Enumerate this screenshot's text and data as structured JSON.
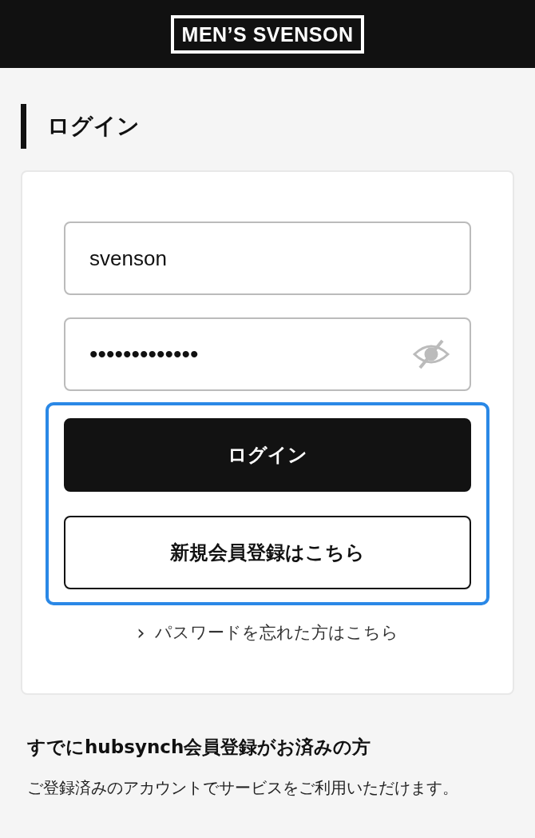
{
  "header": {
    "logo": "MEN’S SVENSON"
  },
  "page_title": "ログイン",
  "login_form": {
    "username": {
      "value": "svenson"
    },
    "password": {
      "value": "•••••••••••••",
      "revealed": false
    },
    "actions": {
      "focused": true,
      "buttons": [
        {
          "label": "ログイン",
          "kind": "primary"
        },
        {
          "label": "新規会員登録はこちら",
          "kind": "secondary"
        }
      ]
    },
    "forgot_link": {
      "icon": "›",
      "label": "パスワードを忘れた方はこちら"
    }
  },
  "hubsynch": {
    "heading": "すでにhubsynch会員登録がお済みの方",
    "text": "ご登録済みのアカウントでサービスをご利用いただけます。"
  }
}
